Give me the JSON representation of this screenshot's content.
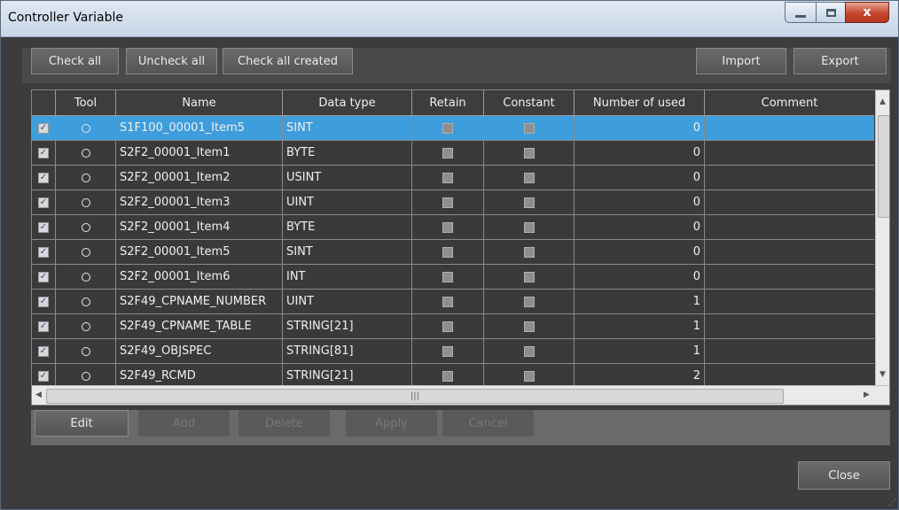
{
  "window": {
    "title": "Controller Variable",
    "close_glyph": "x"
  },
  "toolbar": {
    "check_all": "Check all",
    "uncheck_all": "Uncheck all",
    "check_all_created": "Check all created",
    "import": "Import",
    "export": "Export"
  },
  "table": {
    "columns": [
      "",
      "Tool",
      "Name",
      "Data type",
      "Retain",
      "Constant",
      "Number of used",
      "Comment"
    ],
    "rows": [
      {
        "name": "S1F100_00001_Item5",
        "type": "SINT",
        "used": "0",
        "selected": true
      },
      {
        "name": "S2F2_00001_Item1",
        "type": "BYTE",
        "used": "0"
      },
      {
        "name": "S2F2_00001_Item2",
        "type": "USINT",
        "used": "0"
      },
      {
        "name": "S2F2_00001_Item3",
        "type": "UINT",
        "used": "0"
      },
      {
        "name": "S2F2_00001_Item4",
        "type": "BYTE",
        "used": "0"
      },
      {
        "name": "S2F2_00001_Item5",
        "type": "SINT",
        "used": "0"
      },
      {
        "name": "S2F2_00001_Item6",
        "type": "INT",
        "used": "0"
      },
      {
        "name": "S2F49_CPNAME_NUMBER",
        "type": "UINT",
        "used": "1"
      },
      {
        "name": "S2F49_CPNAME_TABLE",
        "type": "STRING[21]",
        "used": "1"
      },
      {
        "name": "S2F49_OBJSPEC",
        "type": "STRING[81]",
        "used": "1"
      },
      {
        "name": "S2F49_RCMD",
        "type": "STRING[21]",
        "used": "2"
      }
    ]
  },
  "actions": {
    "edit": "Edit",
    "add": "Add",
    "delete": "Delete",
    "apply": "Apply",
    "cancel": "Cancel"
  },
  "footer": {
    "close": "Close"
  },
  "colors": {
    "selection": "#3e9ddc",
    "background": "#3c3c3c"
  }
}
